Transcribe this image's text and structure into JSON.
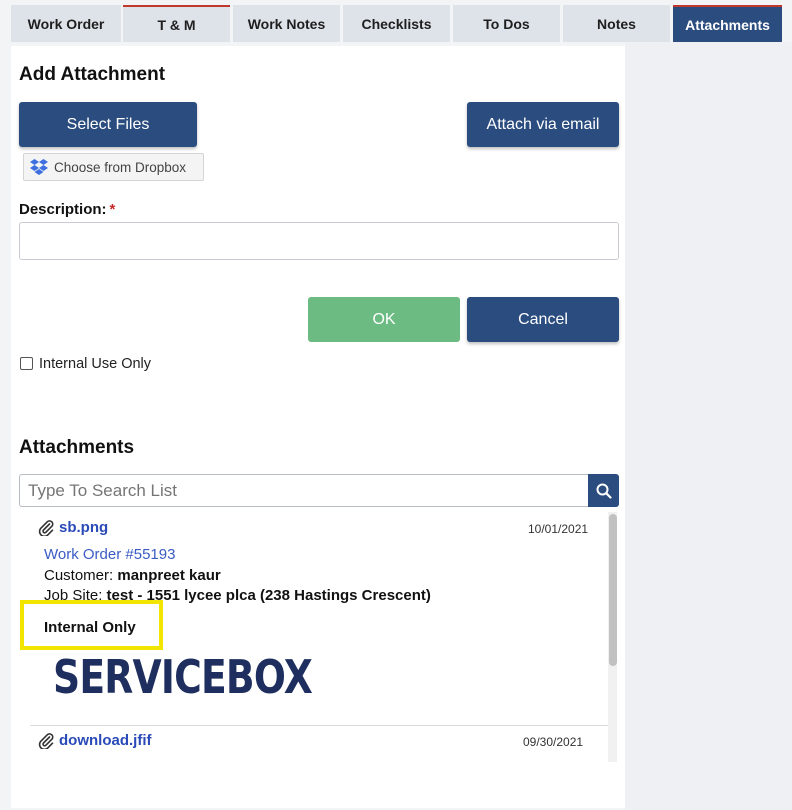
{
  "tabs": [
    {
      "label": "Work Order"
    },
    {
      "label": "T & M"
    },
    {
      "label": "Work Notes"
    },
    {
      "label": "Checklists"
    },
    {
      "label": "To Dos"
    },
    {
      "label": "Notes"
    },
    {
      "label": "Attachments",
      "active": true
    }
  ],
  "add_attachment": {
    "heading": "Add Attachment",
    "select_files_label": "Select Files",
    "attach_email_label": "Attach via email",
    "dropbox_label": "Choose from Dropbox",
    "description_label": "Description:",
    "required_mark": "*",
    "description_value": "",
    "ok_label": "OK",
    "cancel_label": "Cancel",
    "internal_use_label": "Internal Use Only",
    "internal_use_checked": false
  },
  "attachments": {
    "heading": "Attachments",
    "search_placeholder": "Type To Search List",
    "items": [
      {
        "filename": "sb.png",
        "date": "10/01/2021",
        "work_order": "Work Order #55193",
        "customer_label": "Customer:",
        "customer": "manpreet kaur",
        "job_site_label": "Job Site:",
        "job_site": "test - 1551 lycee plca (238 Hastings Crescent)",
        "internal_label": "Internal Only",
        "logo_text": "SERVICEBOX"
      },
      {
        "filename": "download.jfif",
        "date": "09/30/2021"
      }
    ]
  },
  "colors": {
    "primary": "#2a4c7e",
    "ok_button": "#6cbb82",
    "link": "#2a4ab8",
    "highlight": "#f2e500"
  }
}
